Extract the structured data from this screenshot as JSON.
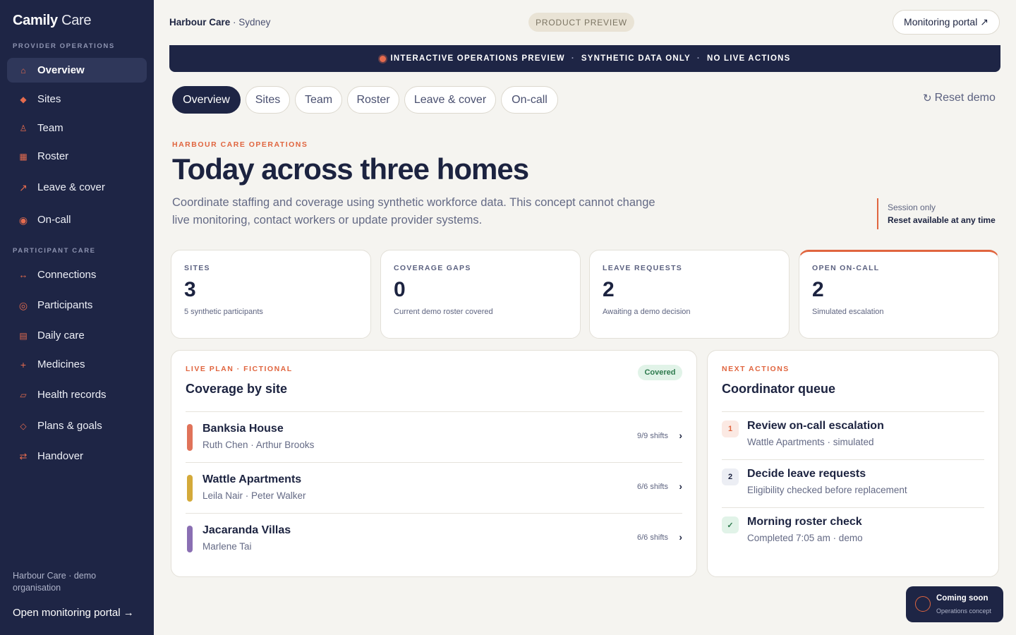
{
  "sidebar": {
    "brand_bold": "Camily",
    "brand_light": "Care",
    "section_provider": "PROVIDER OPERATIONS",
    "section_participant": "PARTICIPANT CARE",
    "provider_items": [
      {
        "label": "Overview",
        "icon": "home-icon",
        "active": true
      },
      {
        "label": "Sites",
        "icon": "diamond-icon"
      },
      {
        "label": "Team",
        "icon": "person-icon"
      },
      {
        "label": "Roster",
        "icon": "grid-icon"
      },
      {
        "label": "Leave & cover",
        "icon": "arrow-icon"
      },
      {
        "label": "On-call",
        "icon": "target-icon"
      }
    ],
    "participant_items": [
      {
        "label": "Connections",
        "icon": "link-icon"
      },
      {
        "label": "Participants",
        "icon": "ring-icon"
      },
      {
        "label": "Daily care",
        "icon": "list-icon"
      },
      {
        "label": "Medicines",
        "icon": "plus-icon"
      },
      {
        "label": "Health records",
        "icon": "record-icon"
      },
      {
        "label": "Plans & goals",
        "icon": "diamond-outline-icon"
      },
      {
        "label": "Handover",
        "icon": "swap-icon"
      }
    ],
    "org_note": "Harbour Care · demo organisation",
    "open_portal": "Open monitoring portal →"
  },
  "header": {
    "org_name": "Harbour Care",
    "location": "· Sydney",
    "preview_badge": "PRODUCT PREVIEW",
    "monitoring_button": "Monitoring portal ↗"
  },
  "banner": {
    "part1": "INTERACTIVE OPERATIONS PREVIEW",
    "part2": "SYNTHETIC DATA ONLY",
    "part3": "NO LIVE ACTIONS",
    "separator": "·"
  },
  "tabs": [
    {
      "label": "Overview",
      "active": true
    },
    {
      "label": "Sites"
    },
    {
      "label": "Team"
    },
    {
      "label": "Roster"
    },
    {
      "label": "Leave & cover"
    },
    {
      "label": "On-call"
    }
  ],
  "reset_label": "Reset demo",
  "hero": {
    "eyebrow": "HARBOUR CARE OPERATIONS",
    "title": "Today across three homes",
    "subtitle": "Coordinate staffing and coverage using synthetic workforce data. This concept cannot change live monitoring, contact workers or update provider systems.",
    "session_line1": "Session only",
    "session_line2": "Reset available at any time"
  },
  "stats": [
    {
      "label": "SITES",
      "value": "3",
      "note": "5 synthetic participants"
    },
    {
      "label": "COVERAGE GAPS",
      "value": "0",
      "note": "Current demo roster covered"
    },
    {
      "label": "LEAVE REQUESTS",
      "value": "2",
      "note": "Awaiting a demo decision"
    },
    {
      "label": "OPEN ON-CALL",
      "value": "2",
      "note": "Simulated escalation"
    }
  ],
  "coverage": {
    "eyebrow": "LIVE PLAN · FICTIONAL",
    "title": "Coverage by site",
    "badge": "Covered",
    "sites": [
      {
        "name": "Banksia House",
        "people": "Ruth Chen · Arthur Brooks",
        "shifts": "9/9 shifts",
        "color": "#e0735a"
      },
      {
        "name": "Wattle Apartments",
        "people": "Leila Nair · Peter Walker",
        "shifts": "6/6 shifts",
        "color": "#d4aa3a"
      },
      {
        "name": "Jacaranda Villas",
        "people": "Marlene Tai",
        "shifts": "6/6 shifts",
        "color": "#8a6fb3"
      }
    ],
    "chevron": "›"
  },
  "queue": {
    "eyebrow": "NEXT ACTIONS",
    "title": "Coordinator queue",
    "items": [
      {
        "badge": "1",
        "title": "Review on-call escalation",
        "sub": "Wattle Apartments · simulated"
      },
      {
        "badge": "2",
        "title": "Decide leave requests",
        "sub": "Eligibility checked before replacement"
      },
      {
        "badge": "✓",
        "title": "Morning roster check",
        "sub": "Completed 7:05 am · demo"
      }
    ]
  },
  "toast": {
    "title": "Coming soon",
    "sub": "Operations concept"
  },
  "colors": {
    "navy": "#1e2545",
    "accent": "#e0653f",
    "covered_green": "#2d7a4d"
  }
}
